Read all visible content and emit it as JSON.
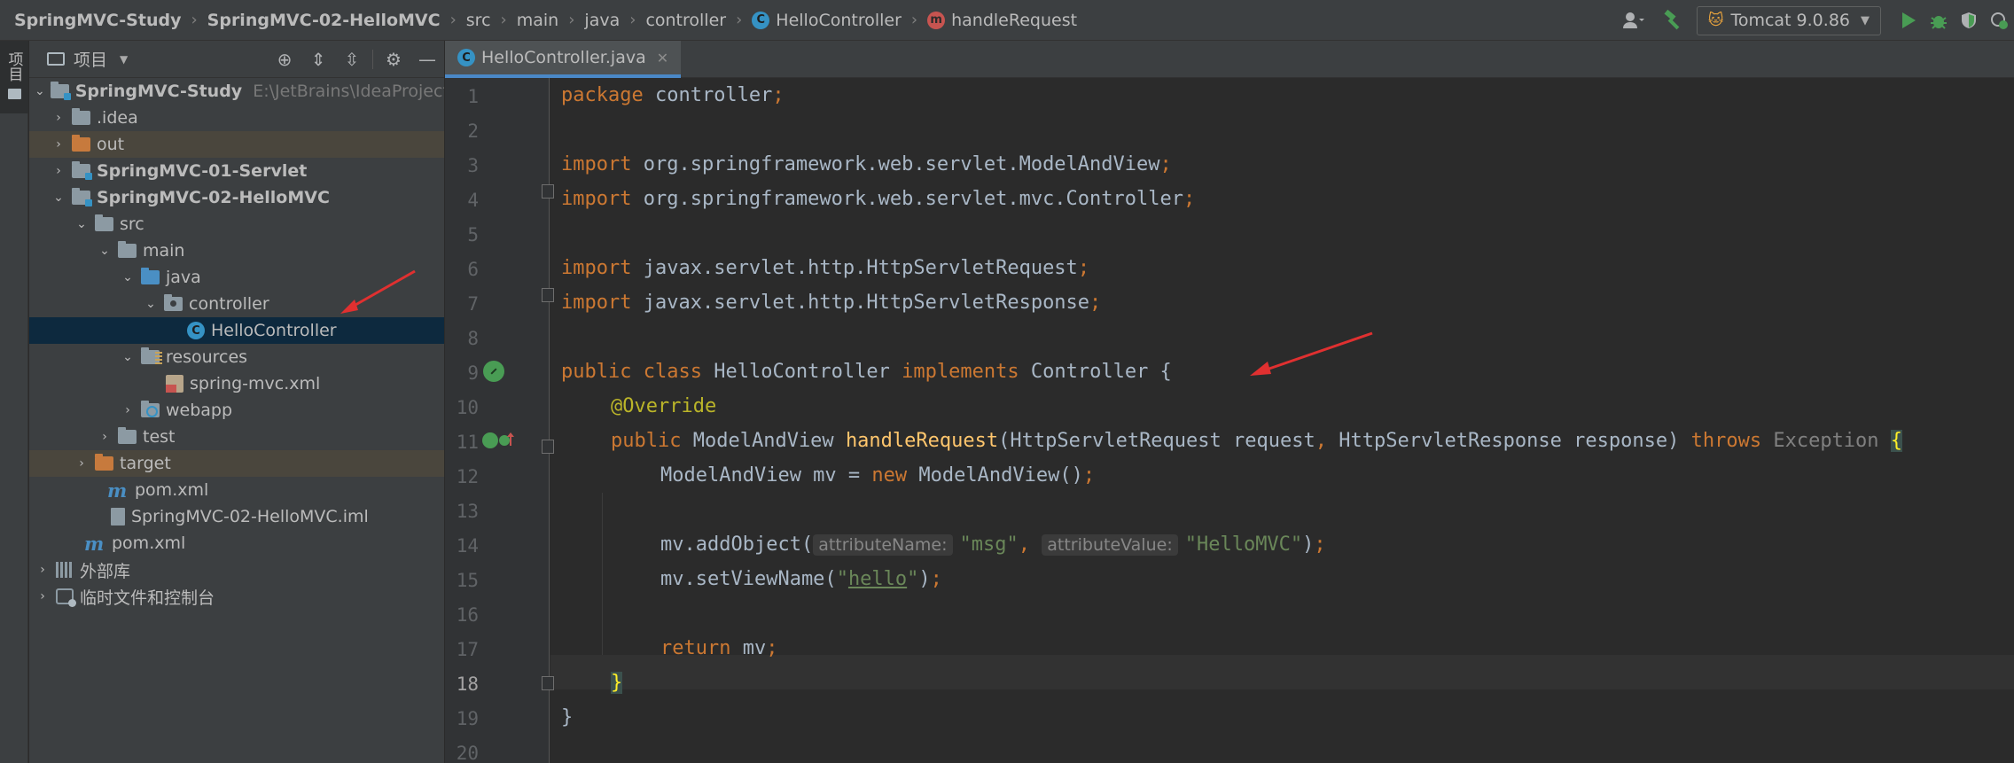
{
  "navbar": {
    "breadcrumbs": [
      {
        "label": "SpringMVC-Study",
        "bold": true
      },
      {
        "label": "SpringMVC-02-HelloMVC",
        "bold": true
      },
      {
        "label": "src"
      },
      {
        "label": "main"
      },
      {
        "label": "java"
      },
      {
        "label": "controller"
      },
      {
        "label": "HelloController",
        "icon": "class-icon"
      },
      {
        "label": "handleRequest",
        "icon": "method-icon"
      }
    ],
    "run_config": "Tomcat 9.0.86",
    "icons": [
      "user-icon",
      "build-hammer-icon",
      "tomcat-icon",
      "run-icon",
      "debug-icon",
      "coverage-icon",
      "profile-icon"
    ]
  },
  "toolstrip": {
    "project_tab_label": "项目"
  },
  "project_panel": {
    "title": "项目",
    "tree": [
      {
        "label": "SpringMVC-Study",
        "path": "E:\\JetBrains\\IdeaProjects\\Sp",
        "bold": true,
        "expanded": true
      },
      {
        "label": ".idea",
        "expanded": false
      },
      {
        "label": "out",
        "expanded": false
      },
      {
        "label": "SpringMVC-01-Servlet",
        "bold": true,
        "expanded": false
      },
      {
        "label": "SpringMVC-02-HelloMVC",
        "bold": true,
        "expanded": true
      },
      {
        "label": "src",
        "expanded": true
      },
      {
        "label": "main",
        "expanded": true
      },
      {
        "label": "java",
        "expanded": true
      },
      {
        "label": "controller",
        "expanded": true
      },
      {
        "label": "HelloController",
        "selected": true
      },
      {
        "label": "resources",
        "expanded": true
      },
      {
        "label": "spring-mvc.xml"
      },
      {
        "label": "webapp",
        "expanded": false
      },
      {
        "label": "test",
        "expanded": false
      },
      {
        "label": "target",
        "expanded": false
      },
      {
        "label": "pom.xml"
      },
      {
        "label": "SpringMVC-02-HelloMVC.iml"
      },
      {
        "label": "pom.xml"
      },
      {
        "label": "外部库",
        "expanded": false
      },
      {
        "label": "临时文件和控制台",
        "expanded": false
      }
    ]
  },
  "editor": {
    "tab_label": "HelloController.java",
    "current_line": 18,
    "line_numbers": [
      "1",
      "2",
      "3",
      "4",
      "5",
      "6",
      "7",
      "8",
      "9",
      "10",
      "11",
      "12",
      "13",
      "14",
      "15",
      "16",
      "17",
      "18",
      "19",
      "20"
    ],
    "code": {
      "l1_kw": "package",
      "l1_id": " controller",
      "l1_semi": ";",
      "l3_kw": "import",
      "l3_id": " org.springframework.web.servlet.ModelAndView",
      "l3_semi": ";",
      "l4_kw": "import",
      "l4_id": " org.springframework.web.servlet.mvc.Controller",
      "l4_semi": ";",
      "l6_kw": "import",
      "l6_id": " javax.servlet.http.HttpServletRequest",
      "l6_semi": ";",
      "l7_kw": "import",
      "l7_id": " javax.servlet.http.HttpServletResponse",
      "l7_semi": ";",
      "l9_kw1": "public",
      "l9_kw2": "class",
      "l9_id1": "HelloController",
      "l9_kw3": "implements",
      "l9_id2": "Controller {",
      "l10_ann": "@Override",
      "l11_kw": "public",
      "l11_type": "ModelAndView",
      "l11_fn": "handleRequest",
      "l11_params1": "(HttpServletRequest request",
      "l11_comma": ",",
      "l11_params2": " HttpServletResponse response) ",
      "l11_throws": "throws",
      "l11_exc": " Exception ",
      "l11_brace": "{",
      "l12_a": "ModelAndView mv = ",
      "l12_new": "new",
      "l12_b": " ModelAndView()",
      "l12_semi": ";",
      "l14_a": "mv.addObject(",
      "l14_hint1": "attributeName:",
      "l14_str1": "\"msg\"",
      "l14_comma": ",",
      "l14_hint2": "attributeValue:",
      "l14_str2": "\"HelloMVC\"",
      "l14_b": ")",
      "l14_semi": ";",
      "l15_a": "mv.setViewName(",
      "l15_q1": "\"",
      "l15_str": "hello",
      "l15_q2": "\"",
      "l15_b": ")",
      "l15_semi": ";",
      "l17_kw": "return",
      "l17_id": " mv",
      "l17_semi": ";",
      "l18_brace": "}",
      "l19_brace": "}"
    }
  },
  "colors": {
    "keyword": "#cc7832",
    "identifier": "#a9b7c6",
    "string": "#6a8759",
    "annotation": "#bbb529",
    "method": "#ffc66d",
    "selection": "#0d293e",
    "annotation_arrow": "#e03030"
  }
}
